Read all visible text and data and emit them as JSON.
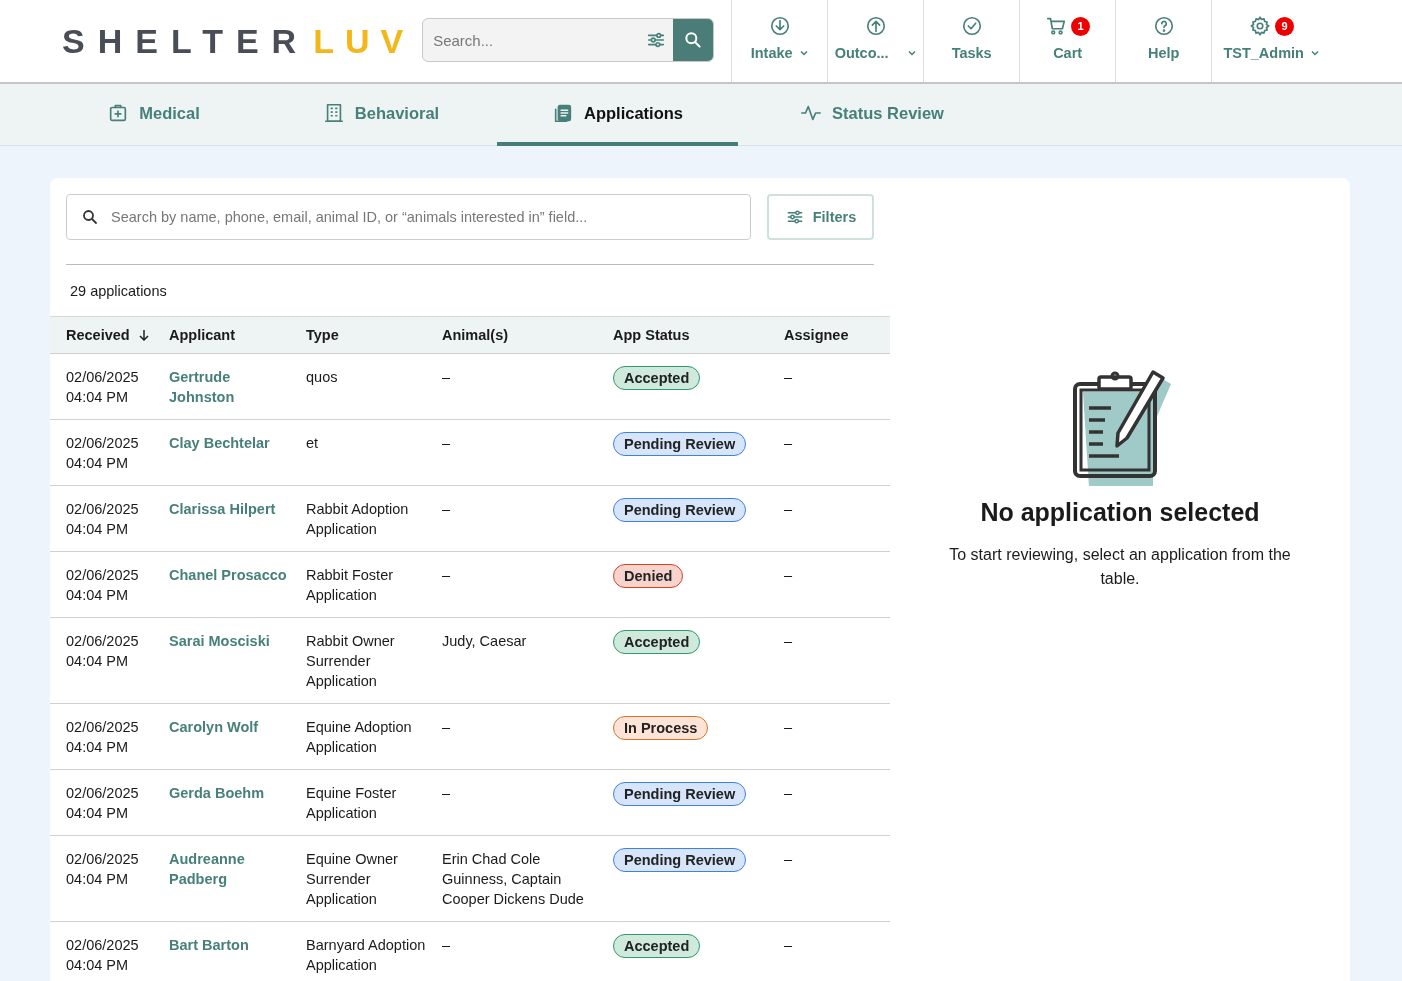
{
  "header": {
    "logo": {
      "first": "SHELTER",
      "second": "LUV"
    },
    "search": {
      "placeholder": "Search..."
    },
    "nav": [
      {
        "label": "Intake",
        "dropdown": true
      },
      {
        "label": "Outco...",
        "dropdown": true
      },
      {
        "label": "Tasks",
        "dropdown": false
      },
      {
        "label": "Cart",
        "dropdown": false,
        "badge": "1"
      },
      {
        "label": "Help",
        "dropdown": false
      },
      {
        "label": "TST_Admin",
        "dropdown": true,
        "badge": "9"
      }
    ]
  },
  "tabs": [
    {
      "label": "Medical",
      "selected": false
    },
    {
      "label": "Behavioral",
      "selected": false
    },
    {
      "label": "Applications",
      "selected": true
    },
    {
      "label": "Status Review",
      "selected": false
    }
  ],
  "list": {
    "search": {
      "placeholder": "Search by name, phone, email, animal ID, or “animals interested in” field..."
    },
    "filters_button": "Filters",
    "count": "29 applications",
    "columns": [
      {
        "label": "Received",
        "sorted": true
      },
      {
        "label": "Applicant",
        "sorted": false
      },
      {
        "label": "Type",
        "sorted": false
      },
      {
        "label": "Animal(s)",
        "sorted": false
      },
      {
        "label": "App Status",
        "sorted": false
      },
      {
        "label": "Assignee",
        "sorted": false
      }
    ],
    "rows": [
      {
        "received": "02/06/2025 04:04 PM",
        "applicant": "Gertrude Johnston",
        "type": "quos",
        "animals": "–",
        "status": {
          "label": "Accepted",
          "kind": "accepted"
        },
        "assignee": "–"
      },
      {
        "received": "02/06/2025 04:04 PM",
        "applicant": "Clay Bechtelar",
        "type": "et",
        "animals": "–",
        "status": {
          "label": "Pending Review",
          "kind": "pending"
        },
        "assignee": "–"
      },
      {
        "received": "02/06/2025 04:04 PM",
        "applicant": "Clarissa Hilpert",
        "type": "Rabbit Adoption Application",
        "animals": "–",
        "status": {
          "label": "Pending Review",
          "kind": "pending"
        },
        "assignee": "–"
      },
      {
        "received": "02/06/2025 04:04 PM",
        "applicant": "Chanel Prosacco",
        "type": "Rabbit Foster Application",
        "animals": "–",
        "status": {
          "label": "Denied",
          "kind": "denied"
        },
        "assignee": "–"
      },
      {
        "received": "02/06/2025 04:04 PM",
        "applicant": "Sarai Mosciski",
        "type": "Rabbit Owner Surrender Application",
        "animals": "Judy, Caesar",
        "status": {
          "label": "Accepted",
          "kind": "accepted"
        },
        "assignee": "–"
      },
      {
        "received": "02/06/2025 04:04 PM",
        "applicant": "Carolyn Wolf",
        "type": "Equine Adoption Application",
        "animals": "–",
        "status": {
          "label": "In Process",
          "kind": "in_process"
        },
        "assignee": "–"
      },
      {
        "received": "02/06/2025 04:04 PM",
        "applicant": "Gerda Boehm",
        "type": "Equine Foster Application",
        "animals": "–",
        "status": {
          "label": "Pending Review",
          "kind": "pending"
        },
        "assignee": "–"
      },
      {
        "received": "02/06/2025 04:04 PM",
        "applicant": "Audreanne Padberg",
        "type": "Equine Owner Surrender Application",
        "animals": "Erin Chad Cole Guinness, Captain Cooper Dickens Dude",
        "status": {
          "label": "Pending Review",
          "kind": "pending"
        },
        "assignee": "–"
      },
      {
        "received": "02/06/2025 04:04 PM",
        "applicant": "Bart Barton",
        "type": "Barnyard Adoption Application",
        "animals": "–",
        "status": {
          "label": "Accepted",
          "kind": "accepted"
        },
        "assignee": "–"
      }
    ]
  },
  "empty_state": {
    "title": "No application selected",
    "message": "To start reviewing, select an application from the table."
  }
}
